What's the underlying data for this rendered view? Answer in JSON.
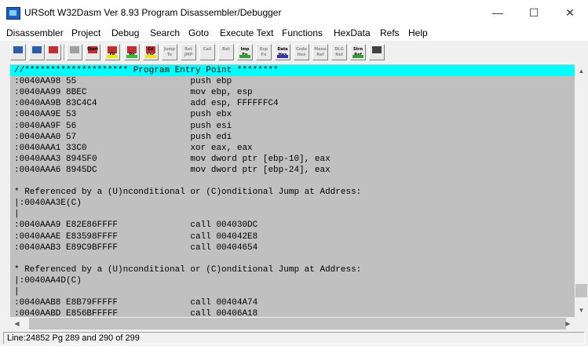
{
  "window": {
    "title": "URSoft W32Dasm Ver 8.93 Program Disassembler/Debugger",
    "minimize": "—",
    "maximize": "☐",
    "close": "✕"
  },
  "menu": [
    "Disassembler",
    "Project",
    "Debug",
    "Search",
    "Goto",
    "Execute Text",
    "Functions",
    "HexData",
    "Refs",
    "Help"
  ],
  "toolbar": {
    "buttons": [
      {
        "name": "open-file-button",
        "icon": "open-folder-icon",
        "l1": "",
        "l2": "",
        "active": true
      },
      {
        "name": "save-file-button",
        "icon": "save-file-icon",
        "l1": "",
        "l2": "",
        "active": true
      },
      {
        "name": "find-text-button",
        "icon": "find-pen-icon",
        "l1": "",
        "l2": "",
        "active": true
      },
      {
        "name": "copy-lines-button",
        "icon": "copy-icon",
        "l1": "",
        "l2": "",
        "active": false
      },
      {
        "name": "goto-code-start-button",
        "icon": "code-start-icon",
        "l1": "Start",
        "l2": "",
        "active": true
      },
      {
        "name": "goto-program-entry-button",
        "icon": "entry-point-icon",
        "l1": "",
        "l2": "EP",
        "active": true
      },
      {
        "name": "goto-page-button",
        "icon": "goto-page-icon",
        "l1": "",
        "l2": "Pg",
        "active": true
      },
      {
        "name": "goto-code-location-button",
        "icon": "code-location-icon",
        "l1": "Cd",
        "l2": "Loc",
        "active": true
      },
      {
        "name": "execute-jump-button",
        "icon": "jump-icon",
        "l1": "Jump",
        "l2": "To",
        "active": false
      },
      {
        "name": "return-from-jump-button",
        "icon": "return-jump-icon",
        "l1": "Ret",
        "l2": "JMP",
        "active": false
      },
      {
        "name": "execute-call-button",
        "icon": "call-icon",
        "l1": "Call",
        "l2": "",
        "active": false
      },
      {
        "name": "return-from-call-button",
        "icon": "return-call-icon",
        "l1": "Ret",
        "l2": "",
        "active": false
      },
      {
        "name": "imported-functions-button",
        "icon": "import-icon",
        "l1": "Imp",
        "l2": "Fn",
        "active": true
      },
      {
        "name": "exported-functions-button",
        "icon": "export-icon",
        "l1": "Exp",
        "l2": "Fn",
        "active": false
      },
      {
        "name": "data-hex-button",
        "icon": "data-hex-icon",
        "l1": "Data",
        "l2": "Hex",
        "active": true
      },
      {
        "name": "code-hex-button",
        "icon": "code-hex-icon",
        "l1": "Code",
        "l2": "Hex",
        "active": false
      },
      {
        "name": "menu-refs-button",
        "icon": "menu-refs-icon",
        "l1": "Menu",
        "l2": "Ref",
        "active": false
      },
      {
        "name": "dialog-refs-button",
        "icon": "dialog-refs-icon",
        "l1": "DLG",
        "l2": "Ref",
        "active": false
      },
      {
        "name": "string-refs-button",
        "icon": "string-refs-icon",
        "l1": "Strn",
        "l2": "Ref",
        "active": true
      },
      {
        "name": "print-button",
        "icon": "printer-icon",
        "l1": "",
        "l2": "",
        "active": true
      }
    ]
  },
  "code_lines": [
    "//******************** Program Entry Point ********",
    ":0040AA98 55                      push ebp",
    ":0040AA99 8BEC                    mov ebp, esp",
    ":0040AA9B 83C4C4                  add esp, FFFFFFC4",
    ":0040AA9E 53                      push ebx",
    ":0040AA9F 56                      push esi",
    ":0040AAA0 57                      push edi",
    ":0040AAA1 33C0                    xor eax, eax",
    ":0040AAA3 8945F0                  mov dword ptr [ebp-10], eax",
    ":0040AAA6 8945DC                  mov dword ptr [ebp-24], eax",
    "",
    "* Referenced by a (U)nconditional or (C)onditional Jump at Address:",
    "|:0040AA3E(C)",
    "|",
    ":0040AAA9 E82E86FFFF              call 004030DC",
    ":0040AAAE E83598FFFF              call 004042E8",
    ":0040AAB3 E89C9BFFFF              call 00404654",
    "",
    "* Referenced by a (U)nconditional or (C)onditional Jump at Address:",
    "|:0040AA4D(C)",
    "|",
    ":0040AAB8 E8B79FFFFF              call 00404A74",
    ":0040AABD E856BFFFFF              call 00406A18"
  ],
  "scroll": {
    "up": "▲",
    "down": "▼",
    "left": "◀",
    "right": "▶",
    "vertical_position": 0.97
  },
  "status": {
    "text": "Line:24852 Pg 289 and 290 of 299"
  }
}
